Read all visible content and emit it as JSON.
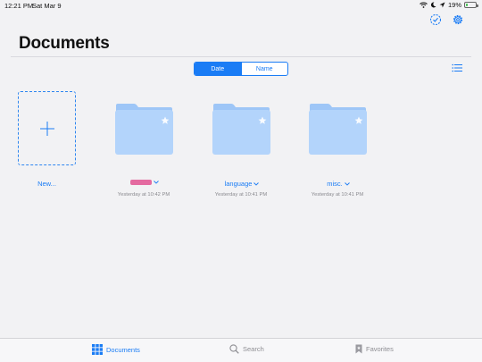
{
  "status_bar": {
    "time": "12:21 PM",
    "date": "Sat Mar 9",
    "battery_percent": "19%",
    "battery_level": 0.19
  },
  "header": {
    "title": "Documents"
  },
  "sort": {
    "options": [
      "Date",
      "Name"
    ],
    "selected": "Date"
  },
  "items": {
    "new_label": "New...",
    "folders": [
      {
        "name": "",
        "redacted": true,
        "date": "Yesterday at 10:42 PM"
      },
      {
        "name": "language",
        "redacted": false,
        "date": "Yesterday at 10:41 PM"
      },
      {
        "name": "misc.",
        "redacted": false,
        "date": "Yesterday at 10:41 PM"
      }
    ]
  },
  "tab_bar": {
    "tabs": [
      {
        "label": "Documents",
        "icon": "grid-icon",
        "active": true
      },
      {
        "label": "Search",
        "icon": "search-icon",
        "active": false
      },
      {
        "label": "Favorites",
        "icon": "bookmark-icon",
        "active": false
      }
    ]
  },
  "colors": {
    "accent": "#1a7cf5",
    "folder": "#b3d4fb",
    "folder_tab": "#9ec6f7",
    "redaction": "#e46aa0"
  }
}
